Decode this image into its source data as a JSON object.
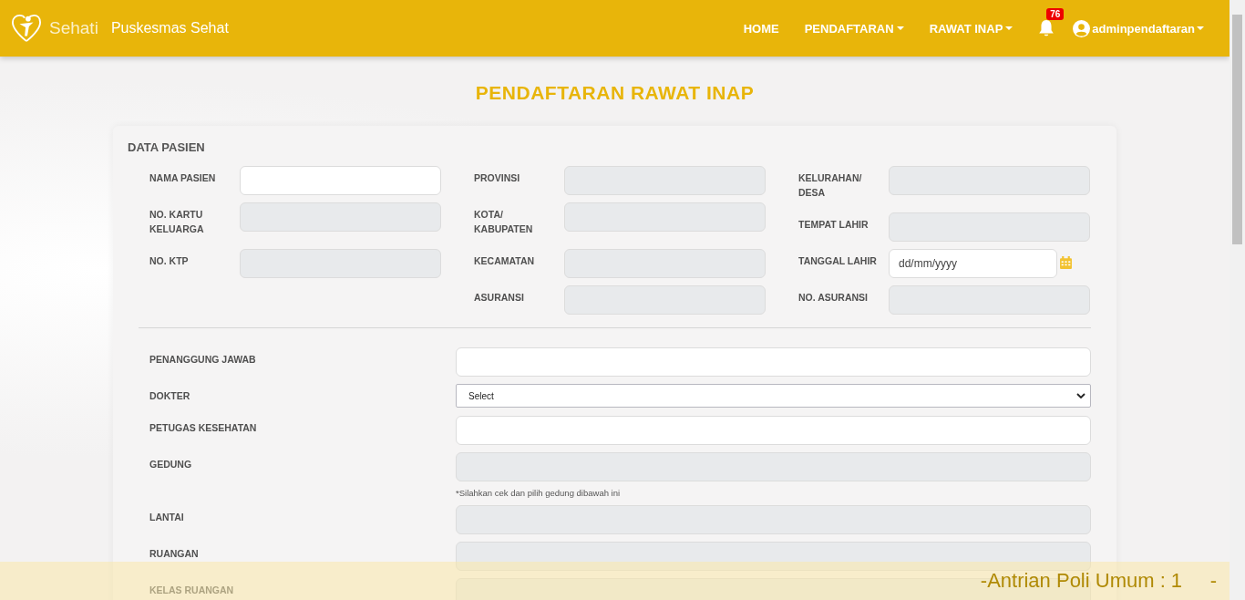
{
  "navbar": {
    "brand": "Sehati",
    "site_name": "Puskesmas Sehat",
    "menu": [
      {
        "label": "HOME",
        "dropdown": false
      },
      {
        "label": "PENDAFTARAN",
        "dropdown": true
      },
      {
        "label": "RAWAT INAP",
        "dropdown": true
      }
    ],
    "notification_count": "76",
    "user": "adminpendaftaran"
  },
  "page_title": "PENDAFTARAN RAWAT INAP",
  "section_title": "DATA PASIEN",
  "patient_columns": [
    [
      {
        "label": "NAMA PASIEN",
        "kind": "input"
      },
      {
        "label": "NO. KARTU KELUARGA",
        "kind": "readonly"
      },
      {
        "label": "NO. KTP",
        "kind": "readonly"
      }
    ],
    [
      {
        "label": "PROVINSI",
        "kind": "readonly"
      },
      {
        "label": "KOTA/ KABUPATEN",
        "kind": "readonly"
      },
      {
        "label": "KECAMATAN",
        "kind": "readonly"
      },
      {
        "label": "ASURANSI",
        "kind": "readonly"
      }
    ],
    [
      {
        "label": "KELURAHAN/ DESA",
        "kind": "readonly"
      },
      {
        "label": "TEMPAT LAHIR",
        "kind": "readonly"
      },
      {
        "label": "TANGGAL LAHIR",
        "kind": "date",
        "placeholder": "dd/mm/yyyy"
      },
      {
        "label": "NO. ASURANSI",
        "kind": "readonly"
      }
    ]
  ],
  "inpatient_fields": [
    {
      "label": "PENANGGUNG JAWAB",
      "kind": "input"
    },
    {
      "label": "DOKTER",
      "kind": "select",
      "value": "Select"
    },
    {
      "label": "PETUGAS KESEHATAN",
      "kind": "input"
    },
    {
      "label": "GEDUNG",
      "kind": "readonly",
      "hint": "*Silahkan cek dan pilih gedung dibawah ini"
    },
    {
      "label": "LANTAI",
      "kind": "readonly"
    },
    {
      "label": "RUANGAN",
      "kind": "readonly"
    },
    {
      "label": "KELAS RUANGAN",
      "kind": "readonly"
    }
  ],
  "queue_ticker": "-Antrian Poli Umum : 1     -"
}
